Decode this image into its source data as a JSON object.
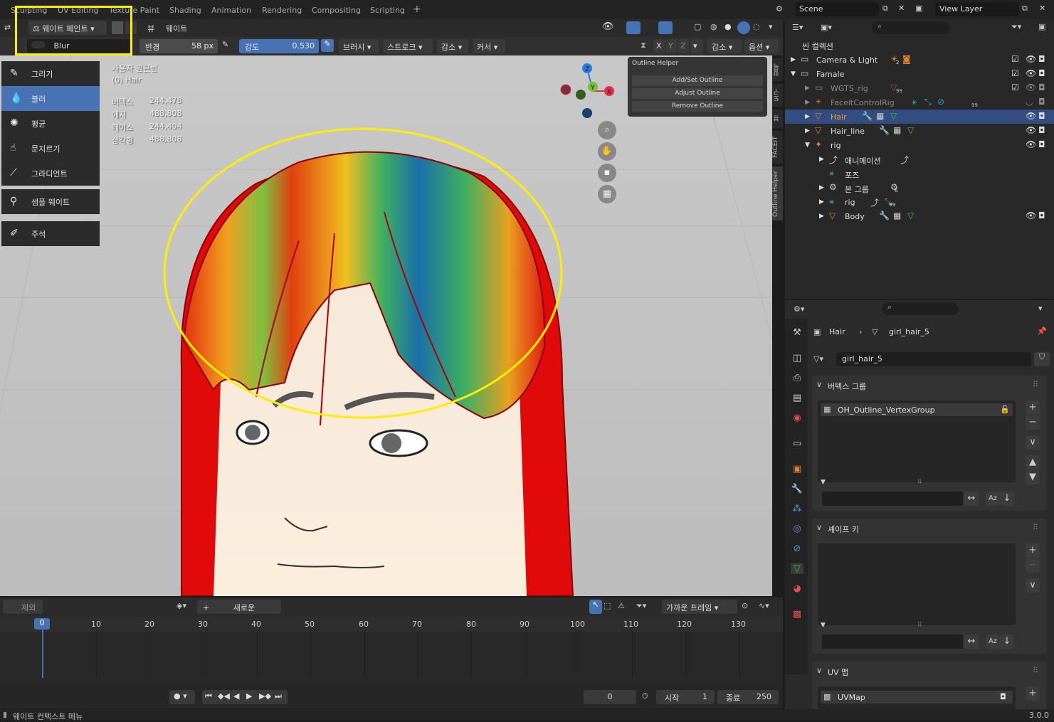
{
  "topbar": {
    "tabs": [
      "Sculpting",
      "UV Editing",
      "Texture Paint",
      "Shading",
      "Animation",
      "Rendering",
      "Compositing",
      "Scripting"
    ],
    "add_tab": "+",
    "scene": "Scene",
    "view_layer": "View Layer"
  },
  "vp_header": {
    "mode": "웨이트 페인트",
    "view_menu": "뷰",
    "weight_menu": "웨이트",
    "brush_name": "Blur",
    "radius_label": "반경",
    "radius_value": "58 px",
    "strength_label": "강도",
    "strength_value": "0.530",
    "brush_menu": "브러시",
    "stroke_menu": "스트로크",
    "falloff_menu": "감소",
    "cursor_menu": "커서",
    "mirror_x": "X",
    "mirror_y": "Y",
    "mirror_z": "Z",
    "falloff2": "감소",
    "options": "옵션"
  },
  "tools": [
    {
      "label": "그리기",
      "icon": "draw-icon",
      "glyph": "✎"
    },
    {
      "label": "블러",
      "icon": "blur-icon",
      "glyph": "💧"
    },
    {
      "label": "평균",
      "icon": "average-icon",
      "glyph": "✺"
    },
    {
      "label": "문지르기",
      "icon": "smear-icon",
      "glyph": "☝"
    },
    {
      "label": "그라디언트",
      "icon": "gradient-icon",
      "glyph": "⟋"
    },
    {
      "label": "샘플 웨이트",
      "icon": "sample-weight-icon",
      "glyph": "⚲"
    },
    {
      "label": "주석",
      "icon": "annotate-icon",
      "glyph": "✐"
    }
  ],
  "overlay": {
    "view_name": "사용자 원근법",
    "object": "(0) Hair",
    "stats": [
      {
        "label": "버텍스",
        "value": "244,478"
      },
      {
        "label": "에지",
        "value": "488,808"
      },
      {
        "label": "페이스",
        "value": "244,404"
      },
      {
        "label": "삼각형",
        "value": "488,808"
      }
    ]
  },
  "outline_helper": {
    "title": "Outline Helper",
    "buttons": [
      "Add/Set Outline",
      "Adjust Outline",
      "Remove Outline"
    ]
  },
  "side_tabs": [
    "항목",
    "도구",
    "뷰",
    "FACEIT",
    "Outline Helper"
  ],
  "outliner": {
    "header": "씬 컬렉션",
    "rows": [
      {
        "label": "Camera & Light",
        "indent": 1,
        "selected": false,
        "dim": false
      },
      {
        "label": "Famale",
        "indent": 1,
        "selected": false,
        "dim": false
      },
      {
        "label": "WGTS_rig",
        "indent": 2,
        "selected": false,
        "dim": true
      },
      {
        "label": "FaceitControlRig",
        "indent": 2,
        "selected": false,
        "dim": true
      },
      {
        "label": "Hair",
        "indent": 2,
        "selected": true,
        "dim": false
      },
      {
        "label": "Hair_line",
        "indent": 2,
        "selected": false,
        "dim": false
      },
      {
        "label": "rig",
        "indent": 2,
        "selected": false,
        "dim": false
      },
      {
        "label": "애니메이션",
        "indent": 3,
        "selected": false,
        "dim": false
      },
      {
        "label": "포즈",
        "indent": 3,
        "selected": false,
        "dim": false
      },
      {
        "label": "본 그룹",
        "indent": 3,
        "selected": false,
        "dim": false
      },
      {
        "label": "rig",
        "indent": 3,
        "selected": false,
        "dim": false
      },
      {
        "label": "Body",
        "indent": 3,
        "selected": false,
        "dim": false
      }
    ],
    "badges": {
      "camera": "2",
      "wgts": "99",
      "faceit": "99",
      "bone_group": "6",
      "rig": "99"
    }
  },
  "properties": {
    "breadcrumb_object": "Hair",
    "breadcrumb_mesh": "girl_hair_5",
    "mesh_name": "girl_hair_5",
    "vertex_groups_title": "버텍스 그룹",
    "vertex_group_item": "OH_Outline_VertexGroup",
    "shape_keys_title": "셰이프 키",
    "uv_maps_title": "UV 맵",
    "uv_map_item": "UVMap"
  },
  "timeline": {
    "exclude": "제외",
    "new": "새로운",
    "snap": "가까운 프레임",
    "current_frame": "0",
    "ticks": [
      "0",
      "10",
      "20",
      "30",
      "40",
      "50",
      "60",
      "70",
      "80",
      "90",
      "100",
      "110",
      "120",
      "130"
    ],
    "frame_field": "0",
    "start_label": "시작",
    "start_value": "1",
    "end_label": "종료",
    "end_value": "250"
  },
  "status": {
    "context": "웨이트 컨텍스트 메뉴",
    "version": "3.0.0"
  },
  "colors": {
    "accent": "#4772b3",
    "highlight": "#ffee00",
    "hair_red": "#e10a0a"
  }
}
